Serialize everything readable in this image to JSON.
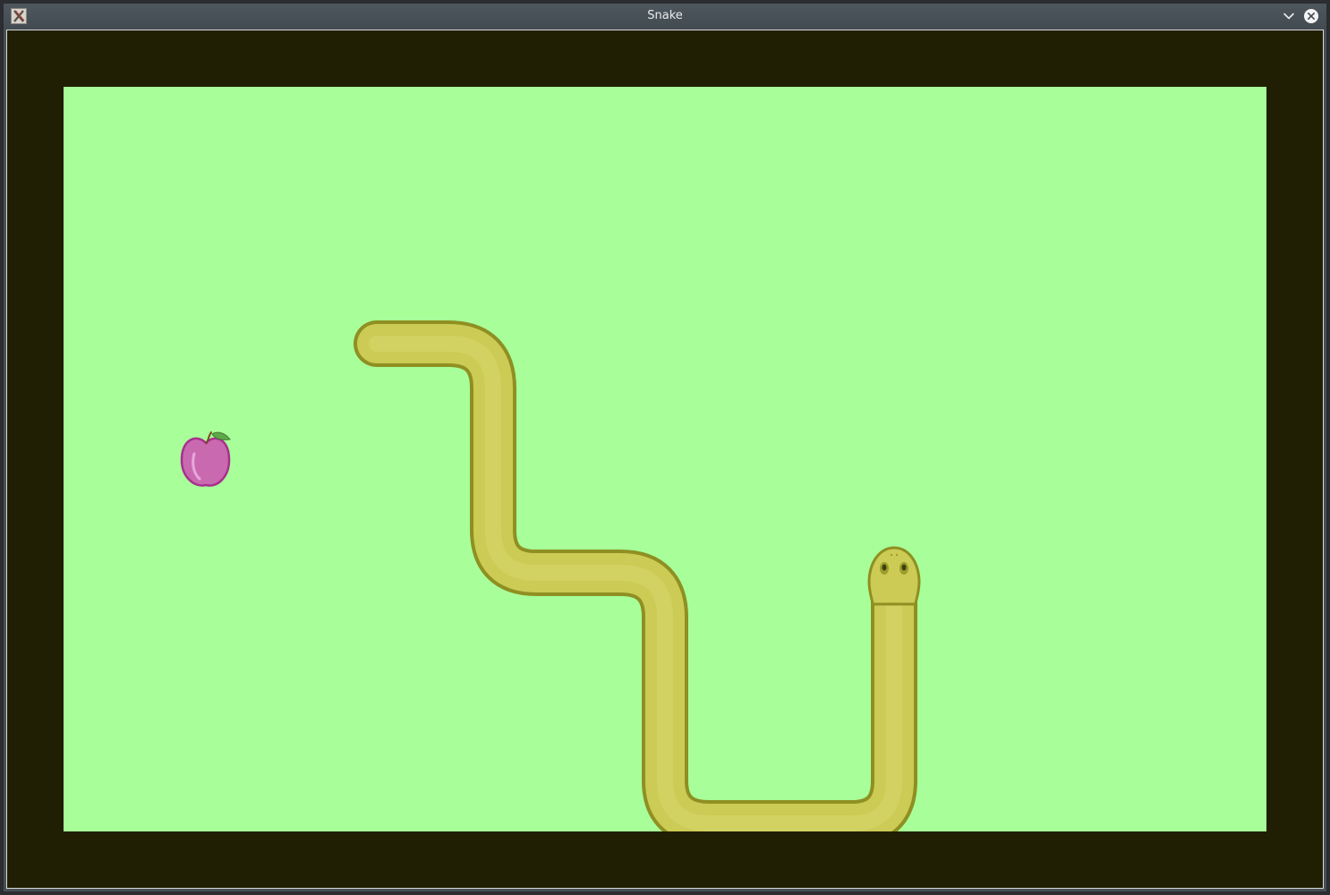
{
  "window": {
    "title": "Snake",
    "app_icon": "x-app-icon",
    "controls": {
      "minimize_icon": "chevron-down-icon",
      "close_icon": "close-circle-icon"
    }
  },
  "game": {
    "board_color": "#a8ff99",
    "border_color": "#201f03",
    "snake_color": "#cbcb55",
    "snake_outline_color": "#8f8f22",
    "apple_color": "#c96ab1",
    "apple_outline_color": "#a8308d",
    "leaf_color": "#5fa84a",
    "snake": {
      "direction": "up",
      "head_icon": "snake-head-icon"
    },
    "food": {
      "icon": "apple-icon"
    }
  }
}
